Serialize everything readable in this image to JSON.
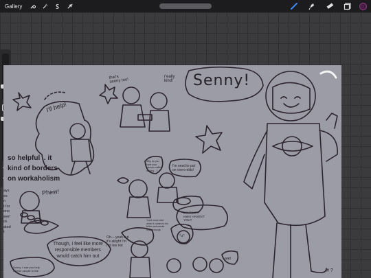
{
  "toolbar": {
    "gallery_label": "Gallery",
    "left_tools": [
      "wrench-icon",
      "magic-wand-icon",
      "selection-icon",
      "transform-arrow-icon"
    ],
    "right_tools": [
      "brush-icon",
      "smudge-icon",
      "eraser-icon",
      "layers-icon"
    ],
    "active_tool": "brush-icon",
    "current_color": "#4a1f46"
  },
  "sidebar": {
    "brush_size": 0.3,
    "opacity": 0.35,
    "modify_button": "square-icon",
    "undo": "↶",
    "redo": "↷"
  },
  "canvas": {
    "background": "#9c9ca6",
    "texts": {
      "senny": "Senny!",
      "ill_help": "I'll help!",
      "thats_sonny": "that's\nsenny too!",
      "really_kind": "r'eally\nkind!",
      "helpful_1": "so helpful .. it",
      "helpful_2": "kind of borders",
      "helpful_3": "on workaholism",
      "phew": "Phew!",
      "need_oven_mitts": "I'm need to put\non oven mitts!",
      "why_do_you": "Why do you\nhave your\nsleeves cuffed\nmaking ..?",
      "yeah_but": "Oh— yeah but\nit's alright I'm\nnot too hot",
      "youre_dont": "Youth more alert\nwhen it comes to his\nfellow astronauts\nhealth though",
      "havent_eaten": "you haven't\neaten HAVEN'T\nYOU?",
      "though_feel": "Though, i feel like more\nresponsible members\nwould catch him out",
      "sonny_help": "Sonny, I saw you help\n5 other people to like",
      "wait": "wait",
      "left_edge": "ays\nes\nn\nt for\none\nwer!\nck\nated\nt",
      "uwu": "^u^",
      "signature": "# ?"
    }
  }
}
